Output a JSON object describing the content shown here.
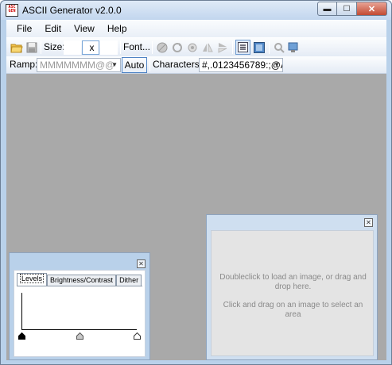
{
  "window": {
    "icon_text": "ASC GEN",
    "title": "ASCII Generator v2.0.0",
    "controls": {
      "minimize": "▬",
      "maximize": "☐",
      "close": "✕"
    }
  },
  "menu": {
    "items": [
      "File",
      "Edit",
      "View",
      "Help"
    ]
  },
  "toolbar": {
    "size_label": "Size:",
    "size_width": "",
    "size_separator": "x",
    "size_height": "",
    "font_label": "Font...",
    "icons": [
      "open-icon",
      "save-icon",
      "sharpen-icon",
      "rotate-icon",
      "dither-icon",
      "flip-horizontal-icon",
      "flip-vertical-icon",
      "text-mode-icon",
      "image-mode-icon",
      "zoom-icon",
      "export-icon"
    ]
  },
  "toolbar2": {
    "ramp_label": "Ramp:",
    "ramp_value": "MMMMMMM@@",
    "auto_label": "Auto",
    "characters_label": "Characters:",
    "characters_value": "#,.0123456789:;@A"
  },
  "levels_panel": {
    "tabs": [
      "Levels",
      "Brightness/Contrast",
      "Dither"
    ],
    "active_tab": "Levels",
    "handles": [
      {
        "name": "black-point",
        "value": 0,
        "color": "#000000"
      },
      {
        "name": "mid-point",
        "value": 0.5,
        "color": "#c8c8c8"
      },
      {
        "name": "white-point",
        "value": 1,
        "color": "#ffffff"
      }
    ]
  },
  "image_panel": {
    "message_line1": "Doubleclick to load an image, or drag and drop here.",
    "message_line2": "Click and drag on an image to select an area"
  },
  "colors": {
    "workspace": "#a9a9a9",
    "frame": "#b9d1ea",
    "accent": "#4e83c4"
  }
}
